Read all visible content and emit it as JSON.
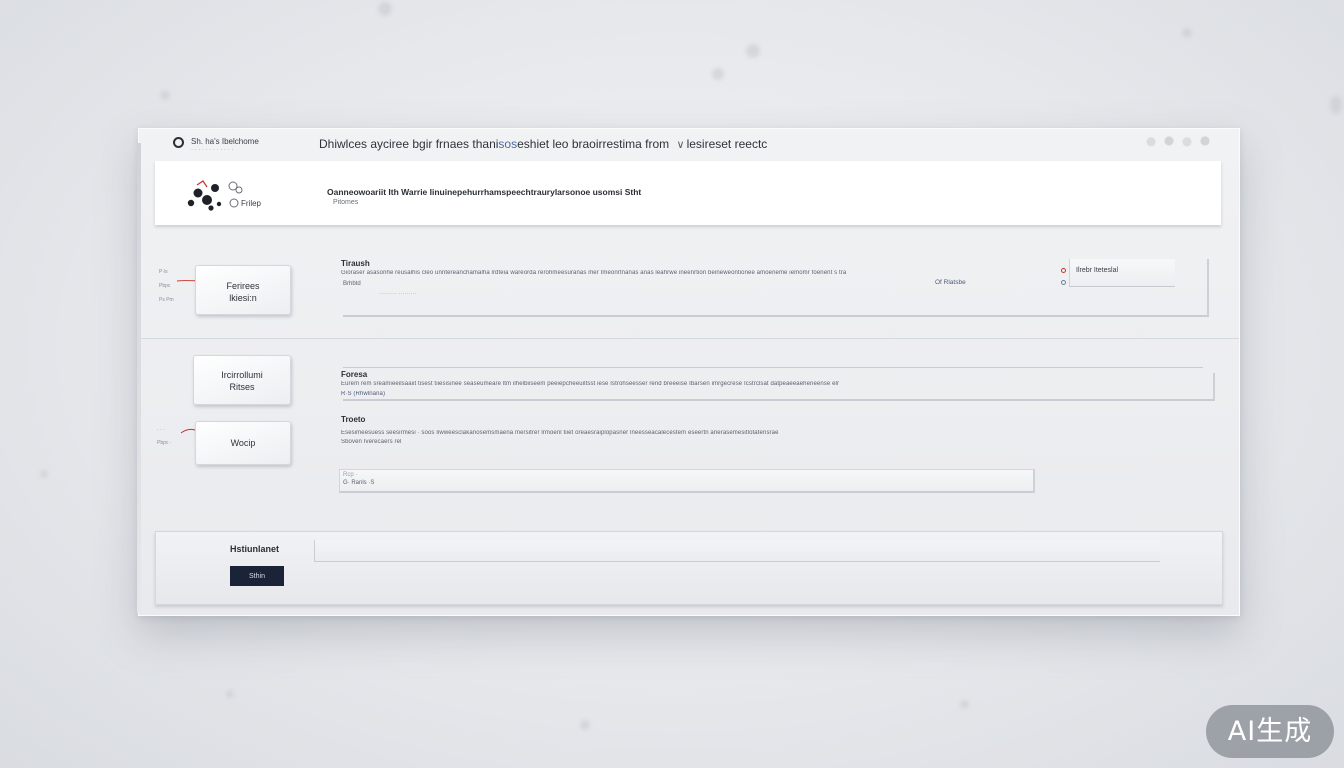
{
  "app": {
    "name": "Sh. ha's Ibelchome",
    "subtitle": "· ·  · · ·   · ·  · · · · ·"
  },
  "window": {
    "title_start": "Dhiwlces ayciree bgir frnaes  thani",
    "title_accent": "sos",
    "title_end": "eshiet leo braoirrestima from",
    "title_tail": "lesireset reectc"
  },
  "header": {
    "logo_label": "Frilep",
    "title": "Oanneowoariit Ith Warrie Iinuinepehurrhamspeechtraurylarsonoe usomsi Stht",
    "subtitle": "Pitomes"
  },
  "sections": [
    {
      "card_label": "Ferirees\nlkiesi:n",
      "tag_top": "P·ls",
      "tag_mid": "Pbpc",
      "tag_bottom": "Ps Pm",
      "title": "Tiraush",
      "text": "Gioraser asasonhe reusalhis cleo unntereanchamalha lrdteia wareorda rerohmeesuranas mer Imeonrtnanas anas leahrwe ineenrtion beineweontionee amoeneme iemomr foenent s tra",
      "field_value": "Brhbtd",
      "field_ghost": "·········  ·········",
      "option_label": "Ilrebr Iteteslal",
      "option_sub": "Of Rlatsbe"
    },
    {
      "card_label": "Ircirrollumi\nRitses",
      "title": "Foresa",
      "text": "Eurem rem sreamieeilsaaiit tisest tiiesisinee seaseumeare ltm ilhelbiiseem peeiepcheeuiltsst iese Istrohseesser rend breeeise Ibarsen imrgecrese Icstrclsat datpeaeeaeheneense elr",
      "text_2": "R·S (Rhwlnana)"
    },
    {
      "card_label": "Wocip",
      "tag_top": "· ·  ·",
      "tag_mid": "Pbpc ·",
      "title": "Troeto",
      "text": "Esesimeesuess seesirmesi · soos  Iiwweesclakanosemsmaena mersitrer lrmoenl tiiet oreaesraiplopasner lneesseacalecestem eseertn anerasemesitlotaterisrae",
      "text_2": "Sboven Iverecaers rel",
      "field_value": "G· Ranls ·S",
      "field_ghost": "Rcp ·"
    }
  ],
  "footer": {
    "label": "Hstiunlanet",
    "button_label": "Sthin"
  },
  "badge": {
    "label": "AI生成"
  },
  "colors": {
    "accent_blue": "#4a6da8",
    "radio_red": "#c8312f",
    "button_navy": "#1b2338",
    "connector_red": "#c8312f"
  }
}
